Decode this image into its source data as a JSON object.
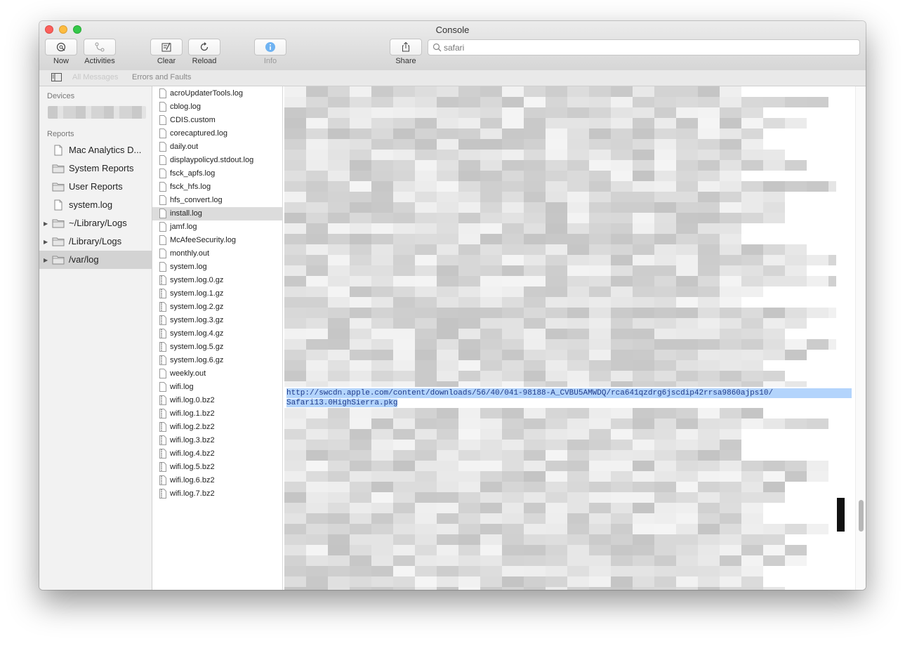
{
  "window": {
    "title": "Console"
  },
  "toolbar": {
    "now": "Now",
    "activities": "Activities",
    "clear": "Clear",
    "reload": "Reload",
    "info": "Info",
    "share": "Share",
    "search_value": "safari"
  },
  "filterbar": {
    "all_messages": "All Messages",
    "errors_and_faults": "Errors and Faults"
  },
  "sidebar": {
    "devices_header": "Devices",
    "reports_header": "Reports",
    "items": [
      {
        "label": "Mac Analytics D...",
        "icon": "document-icon"
      },
      {
        "label": "System Reports",
        "icon": "folder-icon"
      },
      {
        "label": "User Reports",
        "icon": "folder-icon"
      },
      {
        "label": "system.log",
        "icon": "document-icon"
      },
      {
        "label": "~/Library/Logs",
        "icon": "folder-icon"
      },
      {
        "label": "/Library/Logs",
        "icon": "folder-icon"
      },
      {
        "label": "/var/log",
        "icon": "folder-icon",
        "selected": true
      }
    ]
  },
  "files": [
    "acroUpdaterTools.log",
    "cblog.log",
    "CDIS.custom",
    "corecaptured.log",
    "daily.out",
    "displaypolicyd.stdout.log",
    "fsck_apfs.log",
    "fsck_hfs.log",
    "hfs_convert.log",
    "install.log",
    "jamf.log",
    "McAfeeSecurity.log",
    "monthly.out",
    "system.log",
    "system.log.0.gz",
    "system.log.1.gz",
    "system.log.2.gz",
    "system.log.3.gz",
    "system.log.4.gz",
    "system.log.5.gz",
    "system.log.6.gz",
    "weekly.out",
    "wifi.log",
    "wifi.log.0.bz2",
    "wifi.log.1.bz2",
    "wifi.log.2.bz2",
    "wifi.log.3.bz2",
    "wifi.log.4.bz2",
    "wifi.log.5.bz2",
    "wifi.log.6.bz2",
    "wifi.log.7.bz2"
  ],
  "selected_file": "install.log",
  "log": {
    "url_line1": "http://swcdn.apple.com/content/downloads/56/40/041-98188-A_CVBU5AMWDQ/rca641qzdrg6jscdip42rrsa9860ajps10/",
    "url_line2": "Safari13.0HighSierra.pkg"
  },
  "colors": {
    "selection": "#b3d4fc",
    "close": "#fc605c",
    "minimize": "#fdbc40",
    "maximize": "#34c84a",
    "info_blue": "#6fb3f2"
  }
}
